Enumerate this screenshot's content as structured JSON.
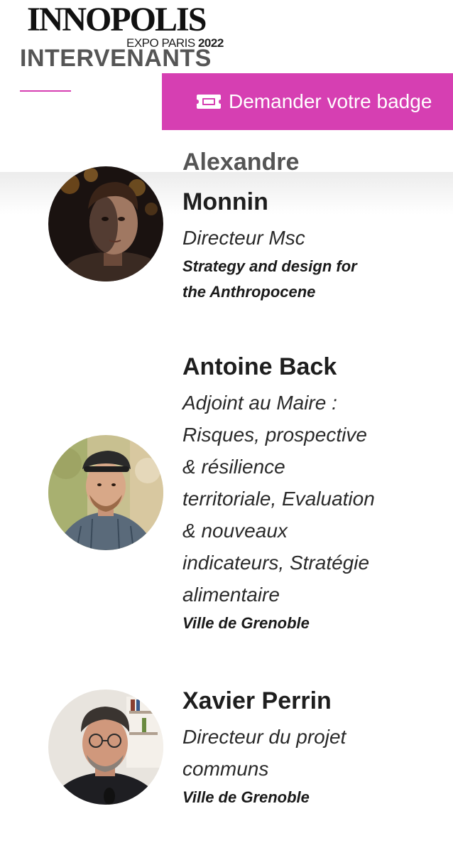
{
  "header": {
    "logo_main": "INNOPOLIS",
    "logo_sub": "EXPO PARIS",
    "logo_year": "2022",
    "section_title": "INTERVENANTS",
    "accent_color": "#d63fb2",
    "badge_icon": "ticket-icon",
    "badge_label": "Demander votre badge"
  },
  "speakers": [
    {
      "first_name": "Alexandre",
      "last_name": "Monnin",
      "role_lines": [
        "Directeur Msc"
      ],
      "org_lines": [
        "Strategy and design for",
        "the Anthropocene"
      ]
    },
    {
      "name": "Antoine Back",
      "role_lines": [
        "Adjoint au Maire :",
        "Risques, prospective",
        "& résilience",
        "territoriale, Evaluation",
        "& nouveaux",
        "indicateurs, Stratégie",
        "alimentaire"
      ],
      "org_lines": [
        "Ville de Grenoble"
      ]
    },
    {
      "name": "Xavier Perrin",
      "role_lines": [
        "Directeur du projet",
        "communs"
      ],
      "org_lines": [
        "Ville de Grenoble"
      ]
    }
  ]
}
